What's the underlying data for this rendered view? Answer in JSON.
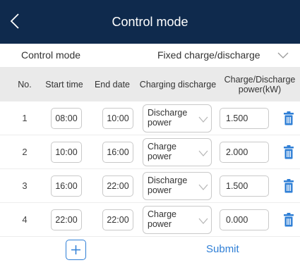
{
  "header": {
    "title": "Control mode",
    "back_icon": "chevron-left-icon"
  },
  "mode": {
    "label": "Control mode",
    "value": "Fixed charge/discharge",
    "chevron_icon": "chevron-down-icon"
  },
  "table": {
    "headers": [
      "No.",
      "Start time",
      "End date",
      "Charging discharge",
      "Charge/Discharge power(kW)"
    ],
    "rows": [
      {
        "no": "1",
        "start": "08:00",
        "end": "10:00",
        "mode": "Discharge power",
        "power": "1.500"
      },
      {
        "no": "2",
        "start": "10:00",
        "end": "16:00",
        "mode": "Charge power",
        "power": "2.000"
      },
      {
        "no": "3",
        "start": "16:00",
        "end": "22:00",
        "mode": "Discharge power",
        "power": "1.500"
      },
      {
        "no": "4",
        "start": "22:00",
        "end": "22:00",
        "mode": "Charge power",
        "power": "0.000"
      }
    ],
    "delete_icon": "trash-icon"
  },
  "footer": {
    "add_icon": "plus-icon",
    "submit_label": "Submit"
  },
  "colors": {
    "header_bg": "#0f2a4d",
    "accent": "#2f7fd6",
    "table_head_bg": "#eaeaea"
  }
}
